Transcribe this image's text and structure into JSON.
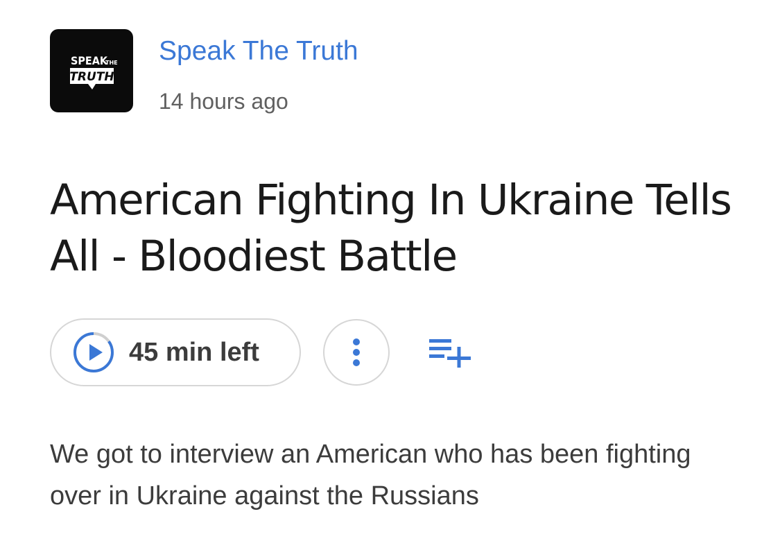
{
  "episode": {
    "channel_name": "Speak The Truth",
    "logo": {
      "line1_main": "SPEAK",
      "line1_small": "THE",
      "line2": "TRUTH",
      "background": "#0b0b0b"
    },
    "published": "14 hours ago",
    "title": "American Fighting In Ukraine Tells All - Bloodiest Battle",
    "description": "We got to interview an American who has been fighting over in Ukraine against the Russians"
  },
  "actions": {
    "play_label": "45 min left",
    "play_icon": "play-progress-icon",
    "progress_fraction": 0.15,
    "more_icon": "more-vertical-icon",
    "add_to_queue_icon": "playlist-add-icon"
  },
  "colors": {
    "accent": "#3b78d6",
    "text_primary": "#1a1a1a",
    "text_secondary": "#606060",
    "border": "#d6d6d6"
  }
}
